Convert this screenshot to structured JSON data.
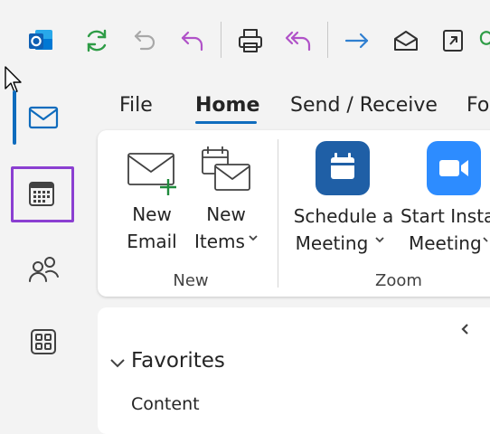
{
  "quick_access": {
    "items": [
      "outlook-logo",
      "sync-icon",
      "undo-icon",
      "reply-icon",
      "print-icon",
      "reply-all-icon",
      "forward-icon",
      "mark-read-icon",
      "open-external-icon"
    ]
  },
  "tabs": [
    "File",
    "Home",
    "Send / Receive",
    "Fo"
  ],
  "ribbon": {
    "new_email": [
      "New",
      "Email"
    ],
    "new_items": [
      "New",
      "Items"
    ],
    "schedule_meeting": [
      "Schedule a",
      "Meeting"
    ],
    "start_instant": [
      "Start Insta",
      "Meeting"
    ],
    "group_new": "New",
    "group_zoom": "Zoom"
  },
  "folders": {
    "favorites": "Favorites",
    "first_item": "Content"
  },
  "colors": {
    "accent": "#0f6cbd",
    "selection": "#8b3fd1",
    "zoom_blue": "#2d8cff",
    "zoom_dark": "#1f5fa6"
  }
}
